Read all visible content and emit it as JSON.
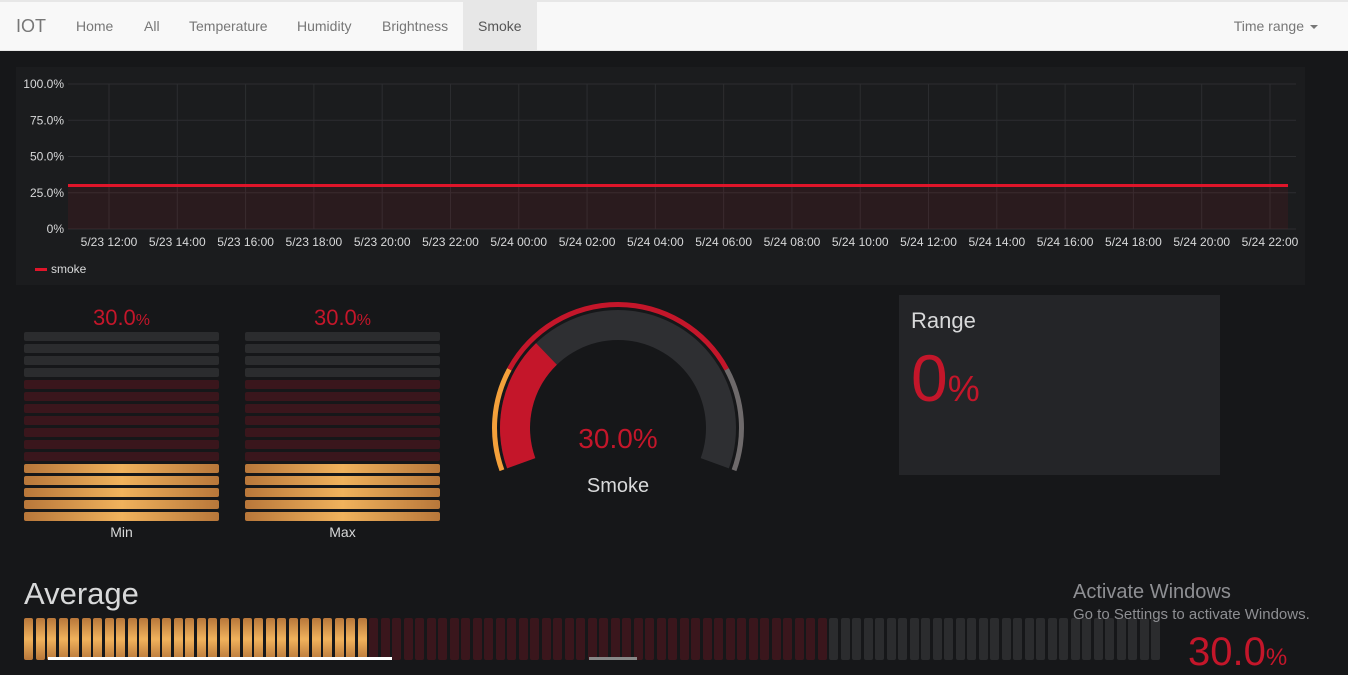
{
  "nav": {
    "brand": "IOT",
    "items": [
      "Home",
      "All",
      "Temperature",
      "Humidity",
      "Brightness",
      "Smoke"
    ],
    "active": "Smoke",
    "time_range": "Time range"
  },
  "chart_data": {
    "type": "area",
    "x_ticks": [
      "5/23 12:00",
      "5/23 14:00",
      "5/23 16:00",
      "5/23 18:00",
      "5/23 20:00",
      "5/23 22:00",
      "5/24 00:00",
      "5/24 02:00",
      "5/24 04:00",
      "5/24 06:00",
      "5/24 08:00",
      "5/24 10:00",
      "5/24 12:00",
      "5/24 14:00",
      "5/24 16:00",
      "5/24 18:00",
      "5/24 20:00",
      "5/24 22:00"
    ],
    "y_ticks": [
      "100.0%",
      "75.0%",
      "50.0%",
      "25.0%",
      "0%"
    ],
    "ylim": [
      0,
      100
    ],
    "series": [
      {
        "name": "smoke",
        "values": [
          30,
          30,
          30,
          30,
          30,
          30,
          30,
          30,
          30,
          30,
          30,
          30,
          30,
          30,
          30,
          30,
          30,
          30
        ],
        "color": "#e0152a"
      }
    ],
    "legend": "bottom-left",
    "grid": true
  },
  "min_gauge": {
    "value": "30.0",
    "unit": "%",
    "label": "Min",
    "level": 0.3
  },
  "max_gauge": {
    "value": "30.0",
    "unit": "%",
    "label": "Max",
    "level": 0.3
  },
  "smoke_gauge": {
    "value": "30.0%",
    "label": "Smoke",
    "level": 0.3
  },
  "range": {
    "title": "Range",
    "value": "0",
    "unit": "%"
  },
  "average": {
    "title": "Average",
    "value": "30.0",
    "unit": "%",
    "level": 0.3
  },
  "watermark": {
    "title": "Activate Windows",
    "subtitle": "Go to Settings to activate Windows."
  },
  "colors": {
    "accent": "#c4162a",
    "line": "#e0152a",
    "bar": "#f0b25c"
  }
}
